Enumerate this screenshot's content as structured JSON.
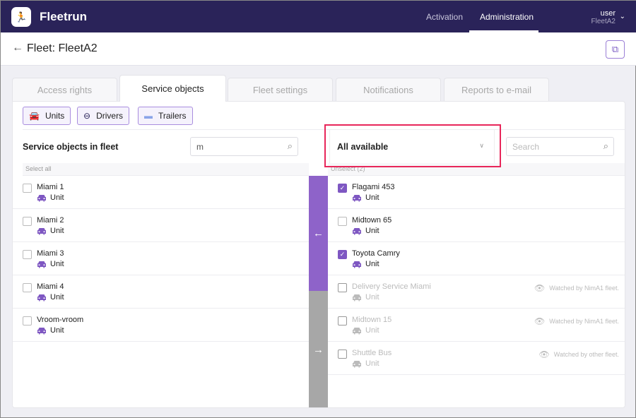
{
  "app": {
    "name": "Fleetrun",
    "nav": [
      "Activation",
      "Administration"
    ],
    "user": "user",
    "user_fleet": "FleetA2"
  },
  "page": {
    "title": "Fleet: FleetA2"
  },
  "tabs": [
    "Access rights",
    "Service objects",
    "Fleet settings",
    "Notifications",
    "Reports to e-mail"
  ],
  "filters": [
    "Units",
    "Drivers",
    "Trailers"
  ],
  "left": {
    "title": "Service objects in fleet",
    "search_value": "m",
    "select_all": "Select all",
    "items": [
      {
        "name": "Miami 1",
        "type": "Unit"
      },
      {
        "name": "Miami 2",
        "type": "Unit"
      },
      {
        "name": "Miami 3",
        "type": "Unit"
      },
      {
        "name": "Miami 4",
        "type": "Unit"
      },
      {
        "name": "Vroom-vroom",
        "type": "Unit"
      }
    ]
  },
  "right": {
    "dropdown": "All available",
    "search_placeholder": "Search",
    "unselect": "Unselect (2)",
    "items": [
      {
        "name": "Flagami 453",
        "type": "Unit",
        "checked": true
      },
      {
        "name": "Midtown 65",
        "type": "Unit",
        "checked": false
      },
      {
        "name": "Toyota Camry",
        "type": "Unit",
        "checked": true
      },
      {
        "name": "Delivery Service Miami",
        "type": "Unit",
        "note": "Watched by NimA1 fleet."
      },
      {
        "name": "Midtown 15",
        "type": "Unit",
        "note": "Watched by NimA1 fleet."
      },
      {
        "name": "Shuttle Bus",
        "type": "Unit",
        "note": "Watched by other fleet."
      }
    ]
  },
  "colors": {
    "accent": "#7e57c2",
    "header": "#2a2359",
    "highlight": "#e8265a"
  }
}
